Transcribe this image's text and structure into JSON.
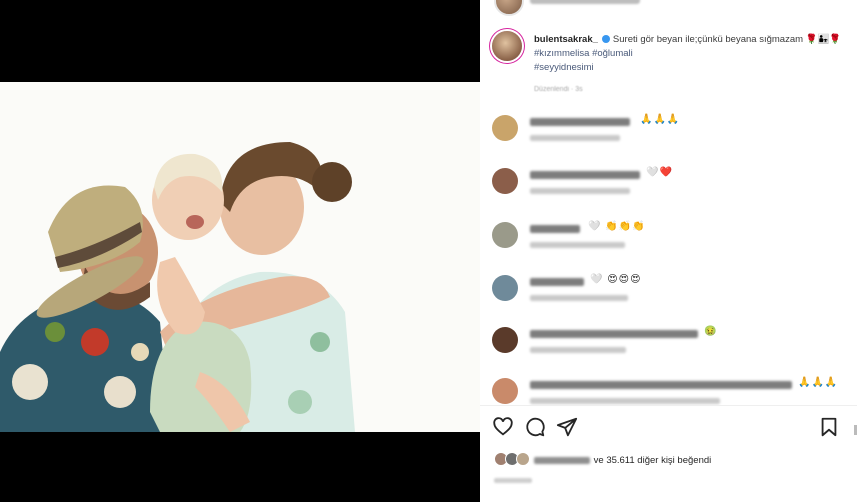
{
  "post": {
    "username": "bulentsakrak_",
    "caption_text": "Sureti gör beyan ile;çünkü beyana sığmazam",
    "hashtags": [
      "#kızımmelisa",
      "#oğlumali",
      "#seyyidnesimi"
    ],
    "caption_meta": "Düzenlendi · 3s"
  },
  "comments": [
    {
      "emoji": "🙏🙏🙏",
      "avatar_color": "#c9a46a"
    },
    {
      "emoji": "🤍❤️",
      "avatar_color": "#8b5e4a"
    },
    {
      "emoji": "🤍 👏👏👏",
      "avatar_color": "#9a9a8a"
    },
    {
      "emoji": "🤍 😍😍😍",
      "avatar_color": "#6f8a9a"
    },
    {
      "emoji": "🤢",
      "avatar_color": "#5a3a2a"
    },
    {
      "emoji": "🙏🙏🙏",
      "avatar_color": "#c98a6a"
    }
  ],
  "likes": {
    "text": "ve 35.611 diğer kişi beğendi"
  },
  "colors": {
    "verified": "#3897f0",
    "hashtag": "#4a5a7a"
  },
  "icons": [
    "heart-icon",
    "comment-icon",
    "share-icon",
    "bookmark-icon"
  ]
}
